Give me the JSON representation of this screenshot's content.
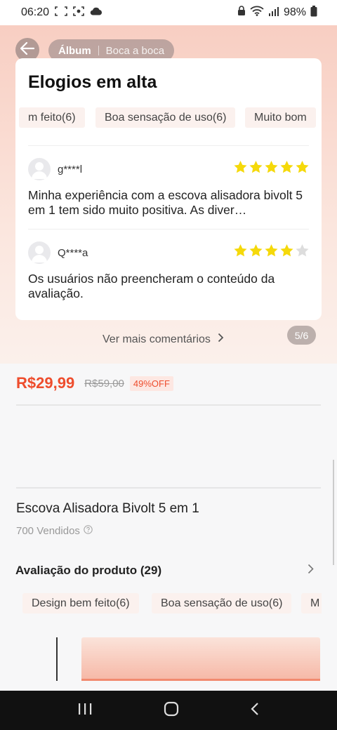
{
  "status_bar": {
    "time": "06:20",
    "battery": "98%"
  },
  "header": {
    "tab_album": "Álbum",
    "tab_word_of_mouth": "Boca a boca"
  },
  "highlights": {
    "title": "Elogios em alta",
    "chips": [
      "m feito(6)",
      "Boa sensação de uso(6)",
      "Muito bom"
    ],
    "reviews": [
      {
        "user": "g****l",
        "rating": 5,
        "text": "Minha experiência com a escova alisadora bivolt 5 em 1 tem sido muito positiva. As diver…"
      },
      {
        "user": "Q****a",
        "rating": 4,
        "text": "Os usuários não preencheram o conteúdo da avaliação."
      }
    ],
    "more_label": "Ver mais comentários",
    "pager": "5/6"
  },
  "product": {
    "price": "R$29,99",
    "old_price": "R$59,00",
    "discount": "49%OFF",
    "title": "Escova Alisadora Bivolt 5 em 1",
    "sold": "700 Vendidos"
  },
  "ratings": {
    "header": "Avaliação do produto (29)",
    "chips": [
      "Design bem feito(6)",
      "Boa sensação de uso(6)",
      "M"
    ]
  },
  "colors": {
    "accent": "#ee4d2d",
    "star": "#f5d90a",
    "star_empty": "#dddddd"
  }
}
